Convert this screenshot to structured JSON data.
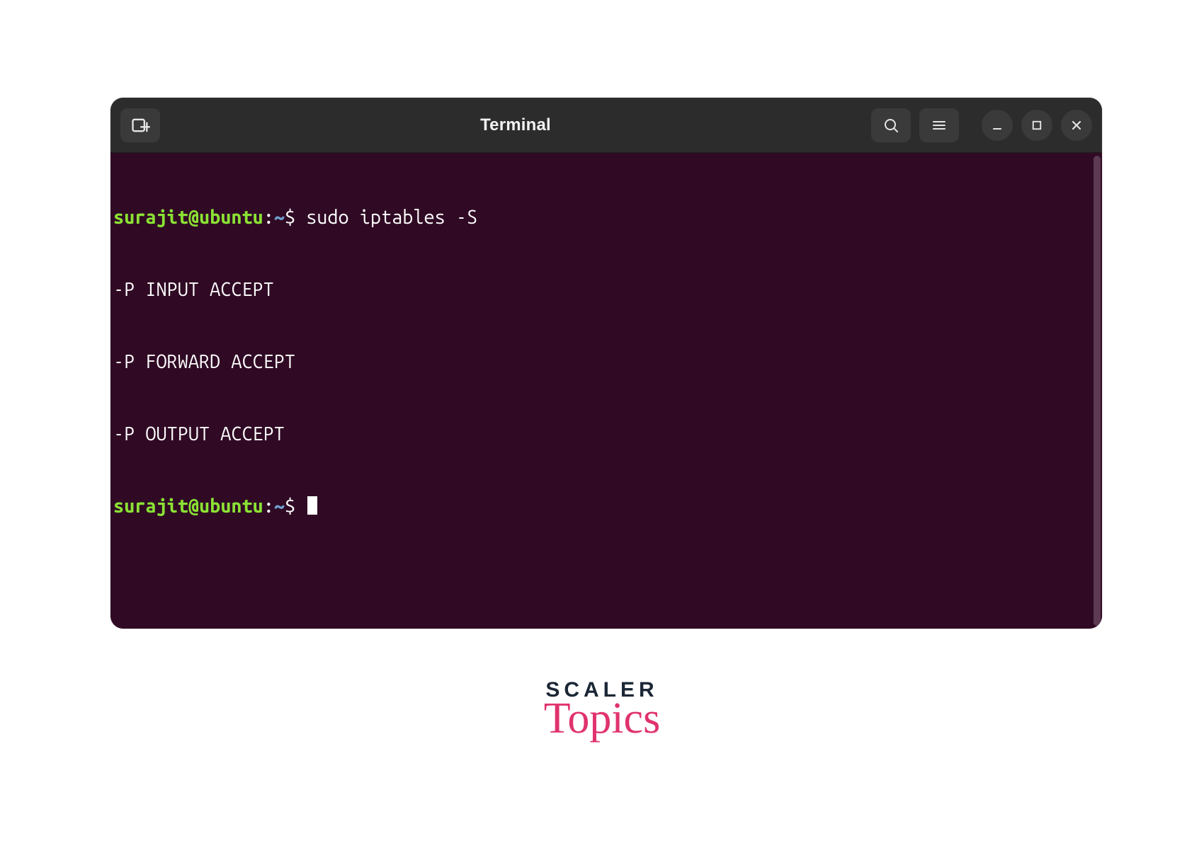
{
  "window": {
    "title": "Terminal",
    "icons": {
      "new_tab": "new-tab-icon",
      "search": "search-icon",
      "menu": "menu-icon",
      "minimize": "minimize-icon",
      "maximize": "maximize-icon",
      "close": "close-icon"
    }
  },
  "terminal": {
    "prompt": {
      "user_host": "surajit@ubuntu",
      "separator": ":",
      "path": "~",
      "symbol": "$"
    },
    "command": "sudo iptables -S",
    "output": [
      "-P INPUT ACCEPT",
      "-P FORWARD ACCEPT",
      "-P OUTPUT ACCEPT"
    ]
  },
  "branding": {
    "line1": "SCALER",
    "line2": "Topics"
  }
}
